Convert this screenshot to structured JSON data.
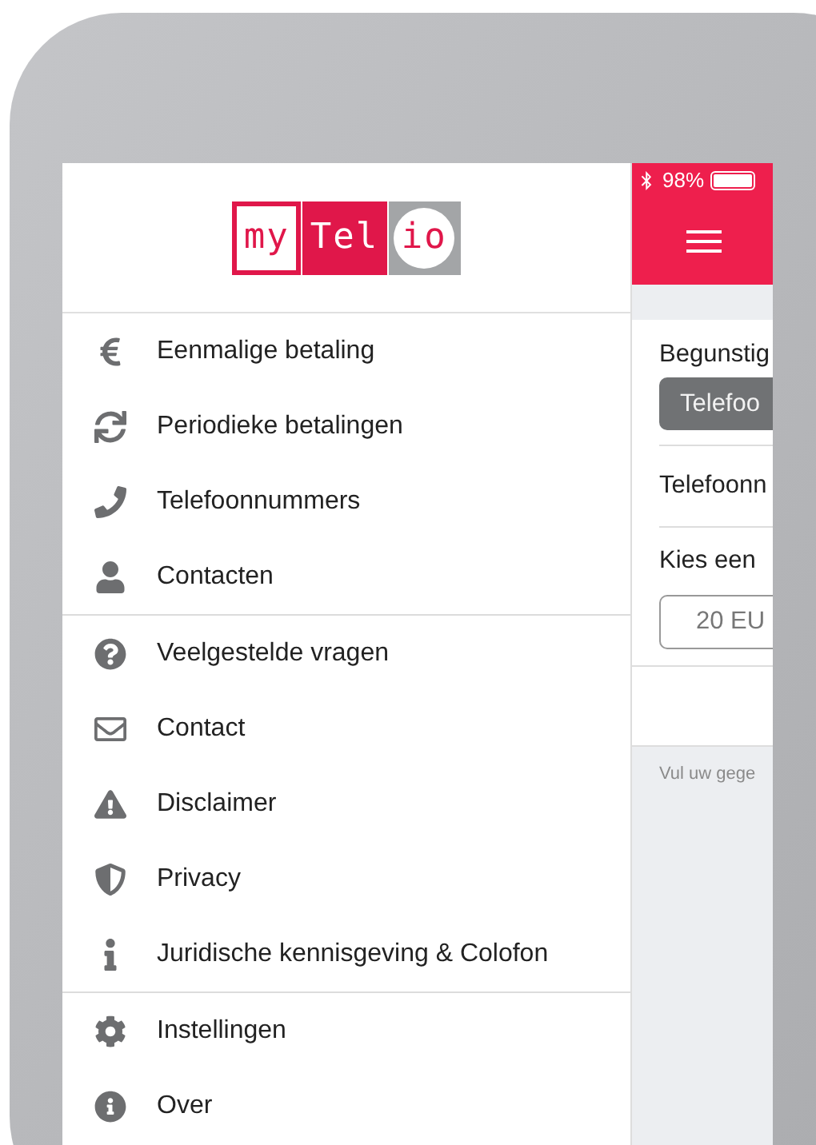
{
  "logo": [
    "my",
    "Tel",
    "io"
  ],
  "menu_sections": [
    {
      "items": [
        {
          "label": "Eenmalige betaling"
        },
        {
          "label": "Periodieke betalingen"
        },
        {
          "label": "Telefoonnummers"
        },
        {
          "label": "Contacten"
        }
      ]
    },
    {
      "items": [
        {
          "label": "Veelgestelde vragen"
        },
        {
          "label": "Contact"
        },
        {
          "label": "Disclaimer"
        },
        {
          "label": "Privacy"
        },
        {
          "label": "Juridische kennisgeving & Colofon"
        }
      ]
    },
    {
      "items": [
        {
          "label": "Instellingen"
        },
        {
          "label": "Over"
        }
      ]
    }
  ],
  "status_bar": {
    "battery": "98%"
  },
  "form": {
    "beneficiary_label": "Begunstig",
    "beneficiary_chip": "Telefoo",
    "phone_label": "Telefoonn",
    "choose_label": "Kies een",
    "amount_value": "20 EU",
    "footer_note": "Vul uw gege"
  }
}
